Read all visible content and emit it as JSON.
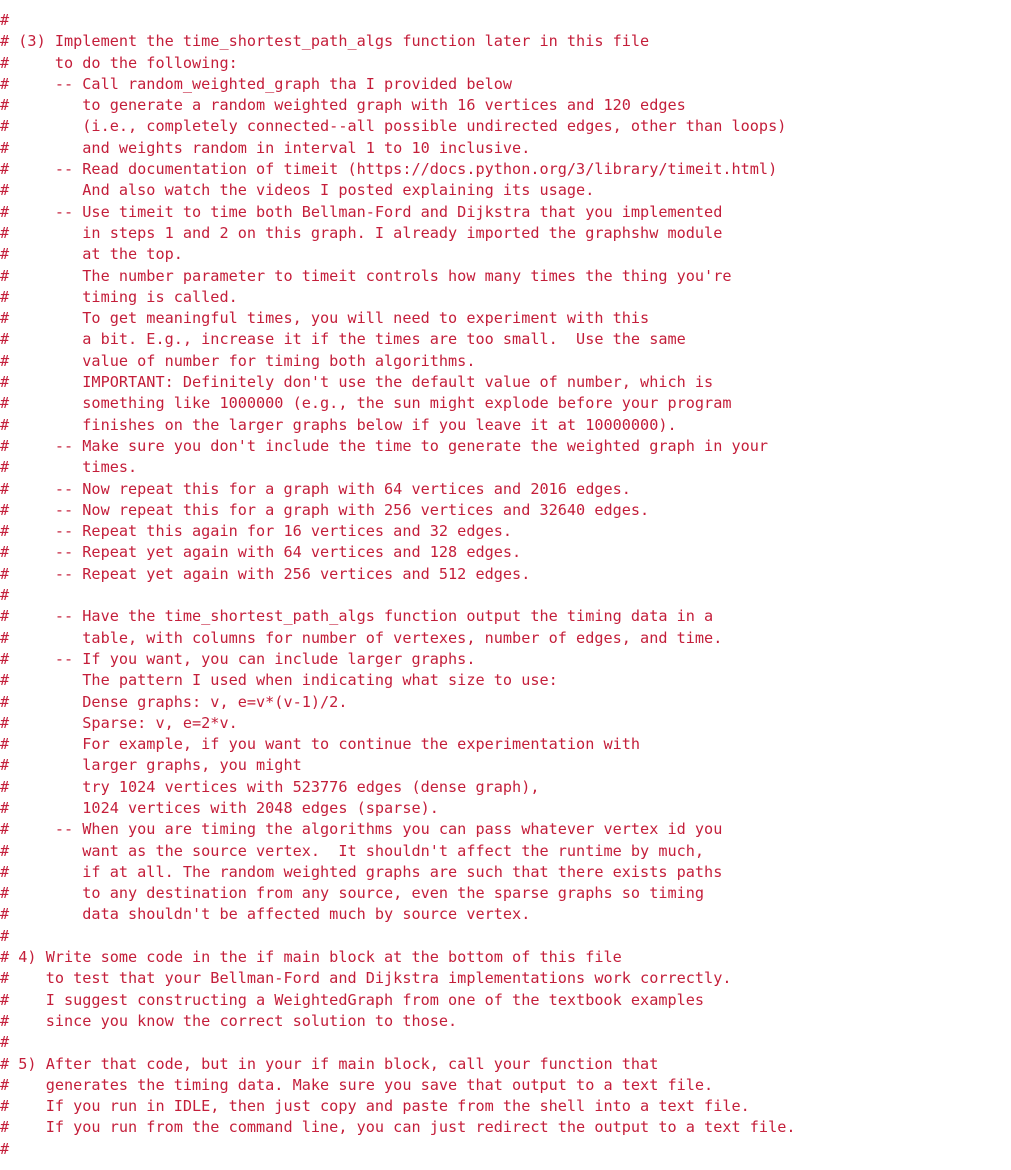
{
  "lines": [
    "#",
    "# (3) Implement the time_shortest_path_algs function later in this file",
    "#     to do the following:",
    "#     -- Call random_weighted_graph tha I provided below",
    "#        to generate a random weighted graph with 16 vertices and 120 edges",
    "#        (i.e., completely connected--all possible undirected edges, other than loops)",
    "#        and weights random in interval 1 to 10 inclusive.",
    "#     -- Read documentation of timeit (https://docs.python.org/3/library/timeit.html)",
    "#        And also watch the videos I posted explaining its usage.",
    "#     -- Use timeit to time both Bellman-Ford and Dijkstra that you implemented",
    "#        in steps 1 and 2 on this graph. I already imported the graphshw module",
    "#        at the top.",
    "#        The number parameter to timeit controls how many times the thing you're",
    "#        timing is called.",
    "#        To get meaningful times, you will need to experiment with this",
    "#        a bit. E.g., increase it if the times are too small.  Use the same",
    "#        value of number for timing both algorithms.",
    "#        IMPORTANT: Definitely don't use the default value of number, which is",
    "#        something like 1000000 (e.g., the sun might explode before your program",
    "#        finishes on the larger graphs below if you leave it at 10000000).",
    "#     -- Make sure you don't include the time to generate the weighted graph in your",
    "#        times.",
    "#     -- Now repeat this for a graph with 64 vertices and 2016 edges.",
    "#     -- Now repeat this for a graph with 256 vertices and 32640 edges.",
    "#     -- Repeat this again for 16 vertices and 32 edges.",
    "#     -- Repeat yet again with 64 vertices and 128 edges.",
    "#     -- Repeat yet again with 256 vertices and 512 edges.",
    "#",
    "#     -- Have the time_shortest_path_algs function output the timing data in a",
    "#        table, with columns for number of vertexes, number of edges, and time.",
    "#     -- If you want, you can include larger graphs.",
    "#        The pattern I used when indicating what size to use:",
    "#        Dense graphs: v, e=v*(v-1)/2.",
    "#        Sparse: v, e=2*v.",
    "#        For example, if you want to continue the experimentation with",
    "#        larger graphs, you might",
    "#        try 1024 vertices with 523776 edges (dense graph),",
    "#        1024 vertices with 2048 edges (sparse).",
    "#     -- When you are timing the algorithms you can pass whatever vertex id you",
    "#        want as the source vertex.  It shouldn't affect the runtime by much,",
    "#        if at all. The random weighted graphs are such that there exists paths",
    "#        to any destination from any source, even the sparse graphs so timing",
    "#        data shouldn't be affected much by source vertex.",
    "#",
    "# 4) Write some code in the if main block at the bottom of this file",
    "#    to test that your Bellman-Ford and Dijkstra implementations work correctly.",
    "#    I suggest constructing a WeightedGraph from one of the textbook examples",
    "#    since you know the correct solution to those.",
    "#",
    "# 5) After that code, but in your if main block, call your function that",
    "#    generates the timing data. Make sure you save that output to a text file.",
    "#    If you run in IDLE, then just copy and paste from the shell into a text file.",
    "#    If you run from the command line, you can just redirect the output to a text file.",
    "#"
  ]
}
